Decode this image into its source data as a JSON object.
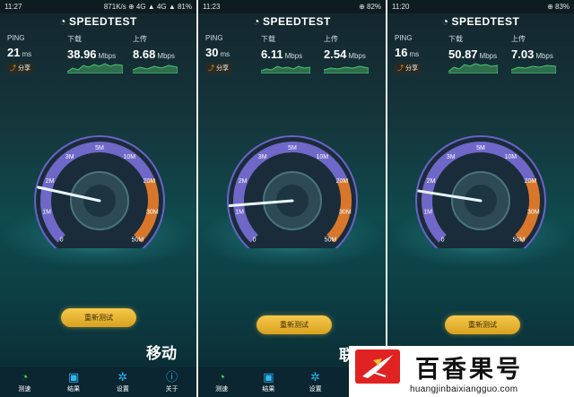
{
  "app": {
    "logo_text": "SPEEDTEST",
    "logo_icon": "gauge-icon"
  },
  "labels": {
    "ping": "PING",
    "download": "下载",
    "upload": "上传",
    "ms": "ms",
    "mbps": "Mbps",
    "share": "分享",
    "retest": "重新测试"
  },
  "gauge_ticks": [
    "0",
    "1M",
    "2M",
    "3M",
    "5M",
    "10M",
    "20M",
    "30M",
    "50M"
  ],
  "nav": [
    "测速",
    "结果",
    "设置",
    "关于"
  ],
  "panels": [
    {
      "status_time": "11:27",
      "status_right": "871K/s ⊕ 4G ▲ 4G ▲ 81%",
      "ping": "21",
      "download": "38.96",
      "upload": "8.68",
      "needle_mbps": 1.7,
      "overlay": "移动"
    },
    {
      "status_time": "11:23",
      "status_right": "⊕ 82%",
      "ping": "30",
      "download": "6.11",
      "upload": "2.54",
      "needle_mbps": 1.2,
      "overlay": "联"
    },
    {
      "status_time": "11:20",
      "status_right": "⊕ 83%",
      "ping": "16",
      "download": "50.87",
      "upload": "7.03",
      "needle_mbps": 1.6,
      "overlay": ""
    }
  ],
  "watermark": {
    "title": "百香果号",
    "url": "huangjinbaixiangguo.com"
  },
  "colors": {
    "gauge_arc": "#7a6fd8",
    "gauge_orange": "#d8772c",
    "retest": "#f0c040",
    "nav_active": "#58d45a"
  }
}
